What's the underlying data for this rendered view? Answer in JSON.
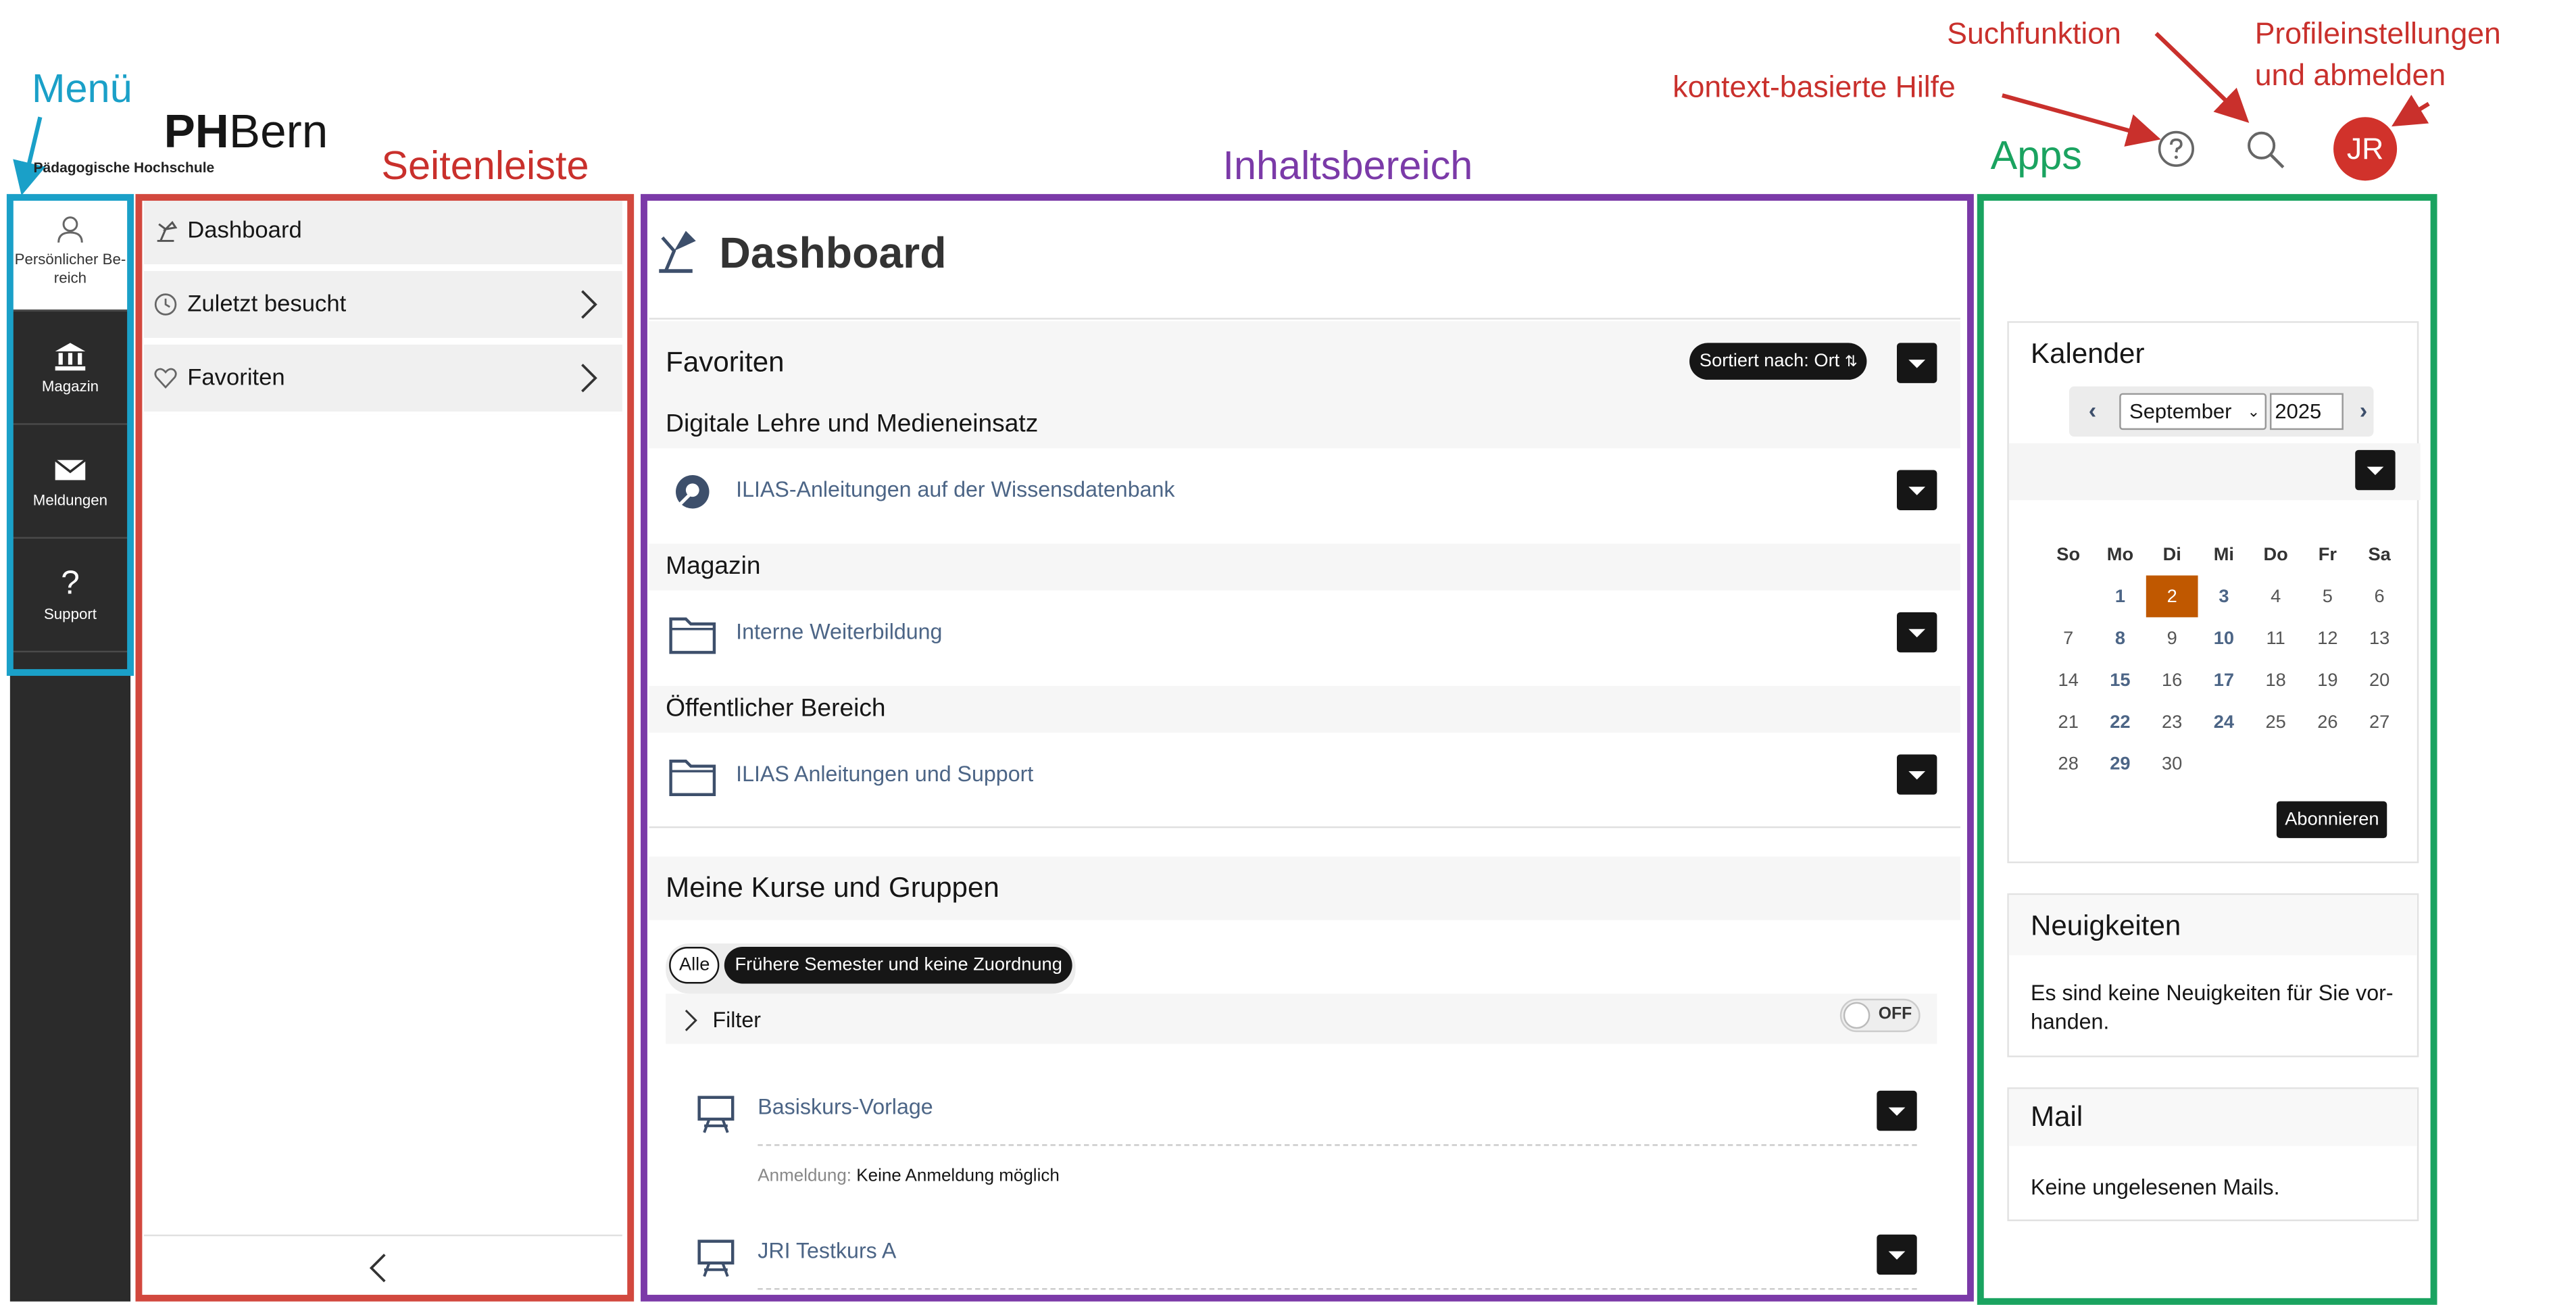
{
  "annotations": {
    "menu": "Menü",
    "sidebar": "Seitenleiste",
    "content": "Inhaltsbereich",
    "apps": "Apps",
    "search": "Suchfunktion",
    "help": "kontext-basierte Hilfe",
    "profile_line1": "Profileinstellungen",
    "profile_line2": "und abmelden"
  },
  "logo": {
    "brand_bold": "PH",
    "brand_light": "Bern",
    "subtitle": "Pädagogische Hochschule"
  },
  "header": {
    "avatar_initials": "JR"
  },
  "mainbar": {
    "items": [
      {
        "label": "Persönlicher Be-\nreich"
      },
      {
        "label": "Magazin"
      },
      {
        "label": "Meldungen"
      },
      {
        "label": "Support"
      }
    ]
  },
  "slate": {
    "items": [
      {
        "label": "Dashboard"
      },
      {
        "label": "Zuletzt besucht"
      },
      {
        "label": "Favoriten"
      }
    ]
  },
  "content": {
    "title": "Dashboard",
    "favorites": {
      "title": "Favoriten",
      "sort_label": "Sortiert nach: Ort",
      "groups": [
        {
          "title": "Digitale Lehre und Medieneinsatz",
          "item": "ILIAS-Anleitungen auf der Wissensdatenbank"
        },
        {
          "title": "Magazin",
          "item": "Interne Weiterbildung"
        },
        {
          "title": "Öffentlicher Bereich",
          "item": "ILIAS Anleitungen und Support"
        }
      ]
    },
    "courses": {
      "title": "Meine Kurse und Gruppen",
      "view_all": "Alle",
      "view_past": "Frühere Semester und keine Zuordnung",
      "filter_label": "Filter",
      "toggle": "OFF",
      "items": [
        {
          "title": "Basiskurs-Vorlage",
          "prop_label": "Anmeldung:",
          "prop_value": "Keine Anmeldung möglich"
        },
        {
          "title": "JRI Testkurs A"
        }
      ]
    }
  },
  "apps": {
    "calendar": {
      "title": "Kalender",
      "month": "September",
      "year": "2025",
      "weekdays": [
        "So",
        "Mo",
        "Di",
        "Mi",
        "Do",
        "Fr",
        "Sa"
      ],
      "weeks": [
        [
          "",
          "1",
          "2",
          "3",
          "4",
          "5",
          "6"
        ],
        [
          "7",
          "8",
          "9",
          "10",
          "11",
          "12",
          "13"
        ],
        [
          "14",
          "15",
          "16",
          "17",
          "18",
          "19",
          "20"
        ],
        [
          "21",
          "22",
          "23",
          "24",
          "25",
          "26",
          "27"
        ],
        [
          "28",
          "29",
          "30",
          "",
          "",
          "",
          ""
        ]
      ],
      "subscribe": "Abonnieren"
    },
    "news": {
      "title": "Neuigkeiten",
      "text": "Es sind keine Neuigkeiten für Sie vor-\nhanden."
    },
    "mail": {
      "title": "Mail",
      "text": "Keine ungelesenen Mails."
    }
  },
  "colors": {
    "annotation_red": "#c9302c",
    "annotation_blue": "#1aa0c8",
    "annotation_purple": "#7b3aa8",
    "annotation_green": "#1aa360",
    "mainbar": "#2b2b2b",
    "link": "#4c6586",
    "today": "#c05800",
    "avatar": "#d1322b"
  }
}
